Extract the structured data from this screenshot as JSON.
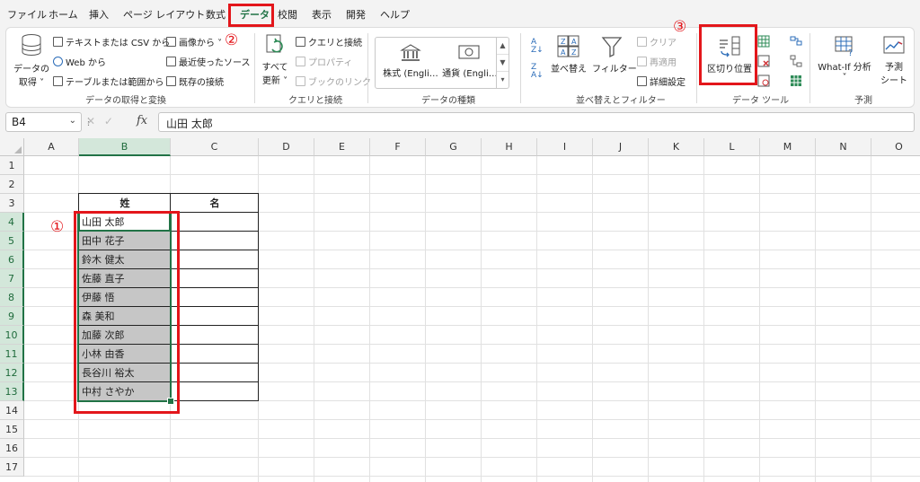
{
  "menu": {
    "tabs": [
      "ファイル",
      "ホーム",
      "挿入",
      "ページ レイアウト",
      "数式",
      "データ",
      "校閲",
      "表示",
      "開発",
      "ヘルプ"
    ],
    "active_tab": "データ"
  },
  "annotations": {
    "n1": "①",
    "n2": "②",
    "n3": "③",
    "box_color": "#e3161b"
  },
  "ribbon": {
    "get_data": {
      "big_label_1": "データの",
      "big_label_2": "取得 ˅",
      "text_csv": "テキストまたは CSV から",
      "web": "Web から",
      "table_range": "テーブルまたは範囲から",
      "image": "画像から ˅",
      "recent": "最近使ったソース",
      "existing": "既存の接続",
      "group": "データの取得と変換"
    },
    "queries": {
      "refresh_1": "すべて",
      "refresh_2": "更新 ˅",
      "queries_conn": "クエリと接続",
      "properties": "プロパティ",
      "edit_links": "ブックのリンク",
      "group": "クエリと接続"
    },
    "data_types": {
      "stocks": "株式 (Engli…",
      "currencies": "通貨 (Engli…",
      "group": "データの種類"
    },
    "sort_filter": {
      "sort": "並べ替え",
      "filter": "フィルター",
      "clear": "クリア",
      "reapply": "再適用",
      "advanced": "詳細設定",
      "group": "並べ替えとフィルター"
    },
    "data_tools": {
      "text_to_columns": "区切り位置",
      "group": "データ ツール"
    },
    "forecast": {
      "whatif": "What-If 分析",
      "whatif_dd": "˅",
      "sheet_1": "予測",
      "sheet_2": "シート",
      "group": "予測"
    }
  },
  "formula_bar": {
    "name_box": "B4",
    "buttons": "✕ ✓",
    "fx": "fx",
    "value": "山田 太郎"
  },
  "sheet": {
    "columns": [
      "A",
      "B",
      "C",
      "D",
      "E",
      "F",
      "G",
      "H",
      "I",
      "J",
      "K",
      "L",
      "M",
      "N",
      "O"
    ],
    "rows": [
      "1",
      "2",
      "3",
      "4",
      "5",
      "6",
      "7",
      "8",
      "9",
      "10",
      "11",
      "12",
      "13",
      "14",
      "15",
      "16",
      "17"
    ],
    "headers": {
      "surname": "姓",
      "given": "名"
    },
    "names": [
      "山田 太郎",
      "田中 花子",
      "鈴木 健太",
      "佐藤 直子",
      "伊藤 悟",
      "森 美和",
      "加藤 次郎",
      "小林 由香",
      "長谷川 裕太",
      "中村 さやか"
    ],
    "selected_range": "B4:B13",
    "accent": "#217346"
  }
}
